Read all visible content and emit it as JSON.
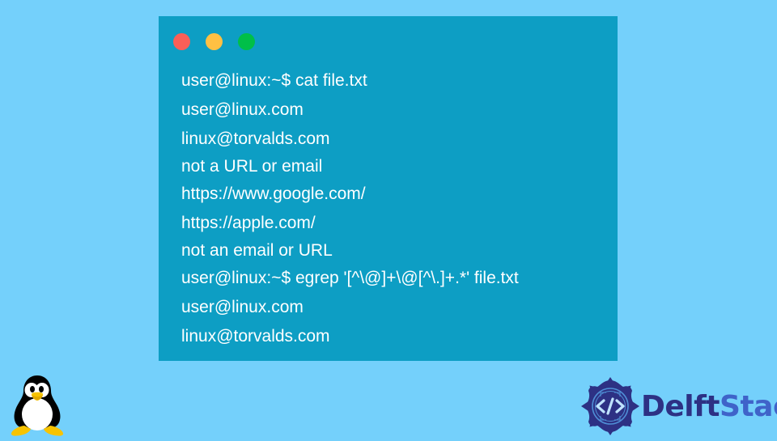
{
  "page": {
    "background_color": "#74d0fb"
  },
  "terminal": {
    "window_color": "#0d9ec4",
    "text_color": "#ffffff",
    "buttons": {
      "close_color": "#f95f57",
      "minimize_color": "#ffc043",
      "maximize_color": "#00bf48"
    },
    "lines": [
      "user@linux:~$ cat file.txt",
      "user@linux.com",
      "linux@torvalds.com",
      "not a URL or email",
      "https://www.google.com/",
      "https://apple.com/",
      "not an email or URL",
      "user@linux:~$ egrep '[^\\@]+\\@[^\\.]+.*' file.txt",
      "user@linux.com",
      "linux@torvalds.com"
    ]
  },
  "branding": {
    "tux": {
      "name": "Linux Tux penguin",
      "body_color": "#000000",
      "belly_color": "#ffffff",
      "beak_color": "#f7c300"
    },
    "delftstack": {
      "word_one": "Delft",
      "word_two": "Stack",
      "emblem_color": "#2d3184",
      "emblem_accent_color": "#4f8fd6",
      "word_one_color": "#2d3184",
      "word_two_color": "#3f63c9",
      "emblem_glyph": "</>"
    }
  }
}
